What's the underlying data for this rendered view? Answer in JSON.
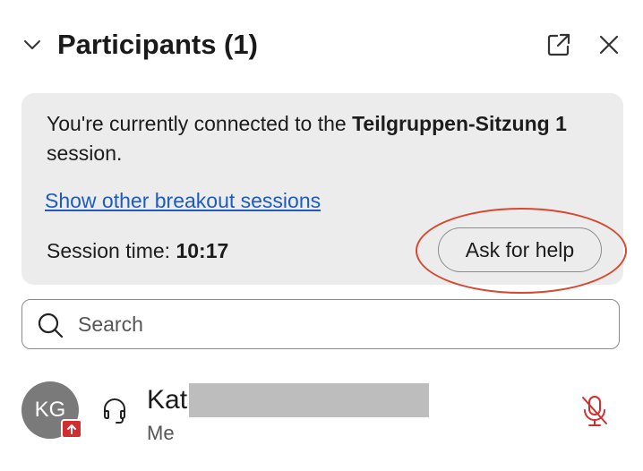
{
  "header": {
    "title": "Participants (1)"
  },
  "session": {
    "text_prefix": "You're currently connected to the ",
    "session_name": "Teilgruppen-Sitzung 1",
    "text_suffix": " session.",
    "other_sessions_link": "Show other breakout sessions",
    "time_label": "Session time: ",
    "time_value": "10:17",
    "help_button": "Ask for help"
  },
  "search": {
    "placeholder": "Search",
    "value": ""
  },
  "participants": [
    {
      "initials": "KG",
      "name": "Kat",
      "role": "Me",
      "muted": true
    }
  ],
  "colors": {
    "accent_link": "#1d5bbf",
    "muted_red": "#d12f2f",
    "annotation_red": "#d9472f",
    "card_background": "#ececec"
  },
  "icons": {
    "collapse": "chevron-down-icon",
    "popout": "popout-icon",
    "close": "close-icon",
    "search": "search-icon",
    "share": "share-badge-icon",
    "headset": "headset-icon",
    "mute": "microphone-muted-icon"
  }
}
